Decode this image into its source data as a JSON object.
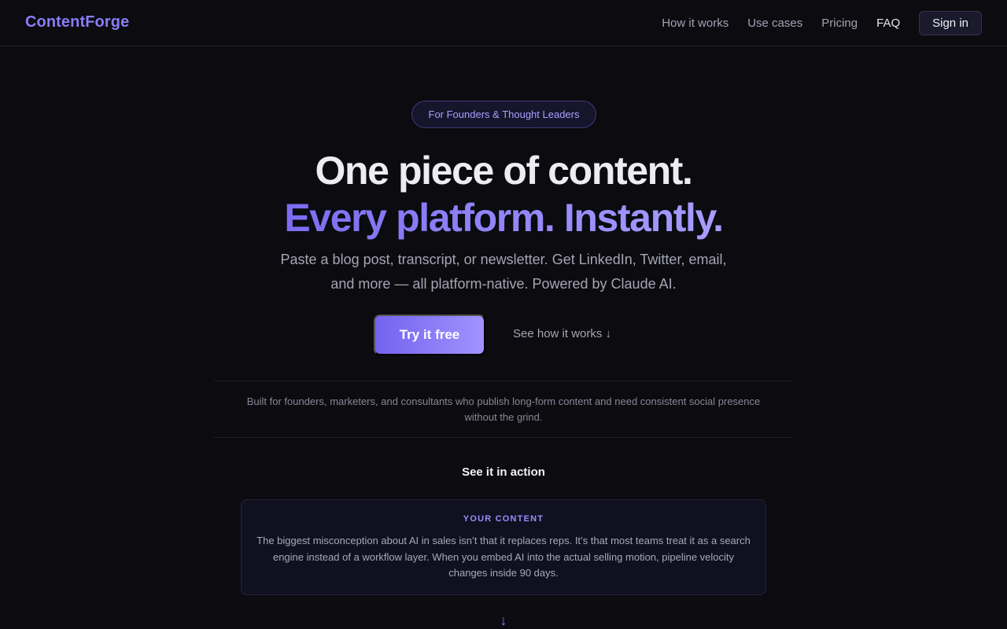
{
  "nav": {
    "logo": "ContentForge",
    "links": [
      {
        "label": "How it works"
      },
      {
        "label": "Use cases"
      },
      {
        "label": "Pricing"
      },
      {
        "label": "FAQ"
      }
    ],
    "signin_label": "Sign in"
  },
  "hero": {
    "badge": "For Founders & Thought Leaders",
    "headline_line1": "One piece of content.",
    "headline_line2": "Every platform. Instantly.",
    "subtitle": "Paste a blog post, transcript, or newsletter. Get LinkedIn, Twitter, email, and more — all platform-native. Powered by Claude AI.",
    "cta_label": "Try it free",
    "secondary_label": "See how it works ↓"
  },
  "built_for": "Built for founders, marketers, and consultants who publish long-form content and need consistent social presence without the grind.",
  "demo": {
    "section_title": "See it in action",
    "card_label": "YOUR CONTENT",
    "card_text": "The biggest misconception about AI in sales isn’t that it replaces reps. It’s that most teams treat it as a search engine instead of a workflow layer. When you embed AI into the actual selling motion, pipeline velocity changes inside 90 days.",
    "arrow": "↓"
  },
  "colors": {
    "background": "#0b0b10",
    "accent": "#8b7cf6",
    "accent_light": "#a99dff"
  }
}
